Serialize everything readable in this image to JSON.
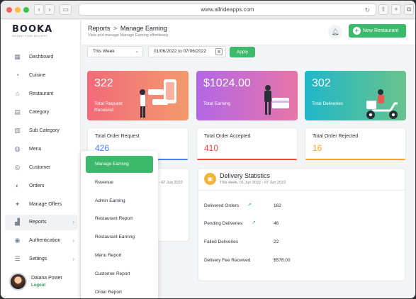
{
  "browser": {
    "url": "www.allrideapps.com"
  },
  "brand": {
    "name": "BOOKA",
    "tagline": "INSTANT FOOD DELIVERY"
  },
  "sidebar": {
    "items": [
      {
        "label": "Dashboard",
        "icon": "dashboard-icon"
      },
      {
        "label": "Cuisine",
        "icon": "cuisine-icon"
      },
      {
        "label": "Restaurant",
        "icon": "restaurant-icon"
      },
      {
        "label": "Category",
        "icon": "category-icon"
      },
      {
        "label": "Sub Category",
        "icon": "sub-category-icon"
      },
      {
        "label": "Menu",
        "icon": "menu-icon"
      },
      {
        "label": "Customer",
        "icon": "customer-icon"
      },
      {
        "label": "Orders",
        "icon": "orders-icon"
      },
      {
        "label": "Manage Offers",
        "icon": "offers-icon"
      },
      {
        "label": "Reports",
        "icon": "reports-icon"
      },
      {
        "label": "Authentication",
        "icon": "authentication-icon"
      },
      {
        "label": "Settings",
        "icon": "settings-icon"
      }
    ],
    "user": {
      "name": "Daiana Power",
      "logout": "Logout"
    }
  },
  "header": {
    "breadcrumb_root": "Reports",
    "breadcrumb_sep": ">",
    "breadcrumb_page": "Manage Earning",
    "subtitle": "View and manage Manage Earning effortlessly",
    "new_button": "New Restaurant"
  },
  "filters": {
    "period": "This Week",
    "date_range": "01/06/2022 to 07/06/2022",
    "apply": "Apply"
  },
  "stats": [
    {
      "value": "322",
      "label": "Total Request Received",
      "color_from": "#f26a7a",
      "color_to": "#f29a6c"
    },
    {
      "value": "$1024.00",
      "label": "Total Earning",
      "color_from": "#b267e6",
      "color_to": "#e775a8"
    },
    {
      "value": "302",
      "label": "Total Deliveries",
      "color_from": "#1fb7c9",
      "color_to": "#68c38c"
    }
  ],
  "orders": [
    {
      "label": "Total Order Request",
      "value": "426",
      "color": "#4c7fe8"
    },
    {
      "label": "Total Order Accepted",
      "value": "410",
      "color": "#e2463f"
    },
    {
      "label": "Total Order Rejected",
      "value": "16",
      "color": "#f0a629"
    }
  ],
  "left_panel": {
    "date": "- 07 Jun 2022"
  },
  "delivery": {
    "title": "Delivery Statistics",
    "date": "This week, 01 Jun 2022 - 07 Jun 2022",
    "rows": [
      {
        "label": "Delivered Orders",
        "value": "162",
        "edit": true
      },
      {
        "label": "Pending Deliveries",
        "value": "46",
        "edit": true
      },
      {
        "label": "Failed Deliveries",
        "value": "22",
        "edit": false
      },
      {
        "label": "Delivery Fee Received",
        "value": "$578.00",
        "edit": false
      }
    ]
  },
  "submenu": {
    "items": [
      {
        "label": "Manage Earning",
        "active": true
      },
      {
        "label": "Revenue"
      },
      {
        "label": "Admin Earning"
      },
      {
        "label": "Restaurant Report"
      },
      {
        "label": "Restaurant Earning"
      },
      {
        "label": "Menu Report"
      },
      {
        "label": "Customer Report"
      },
      {
        "label": "Order Report"
      }
    ]
  }
}
